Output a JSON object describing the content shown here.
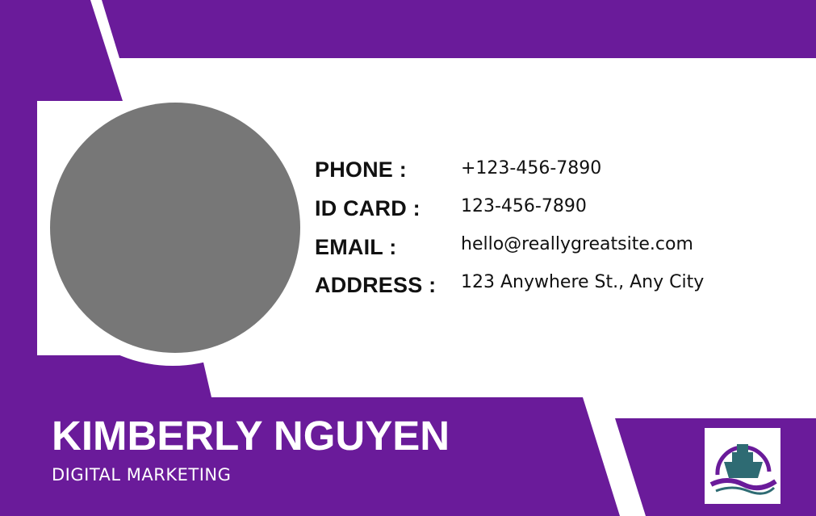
{
  "colors": {
    "primary": "#6a1b9a",
    "photo_placeholder": "#777777",
    "text_dark": "#111111",
    "logo_teal": "#2e6b73"
  },
  "contact": {
    "phone_label": "PHONE :",
    "phone_value": "+123-456-7890",
    "id_label": "ID CARD :",
    "id_value": "123-456-7890",
    "email_label": "EMAIL :",
    "email_value": "hello@reallygreatsite.com",
    "address_label": "ADDRESS :",
    "address_value": "123 Anywhere St., Any City"
  },
  "person": {
    "name": "KIMBERLY NGUYEN",
    "title": "DIGITAL MARKETING"
  },
  "logo": {
    "icon": "ship-logo-icon"
  }
}
